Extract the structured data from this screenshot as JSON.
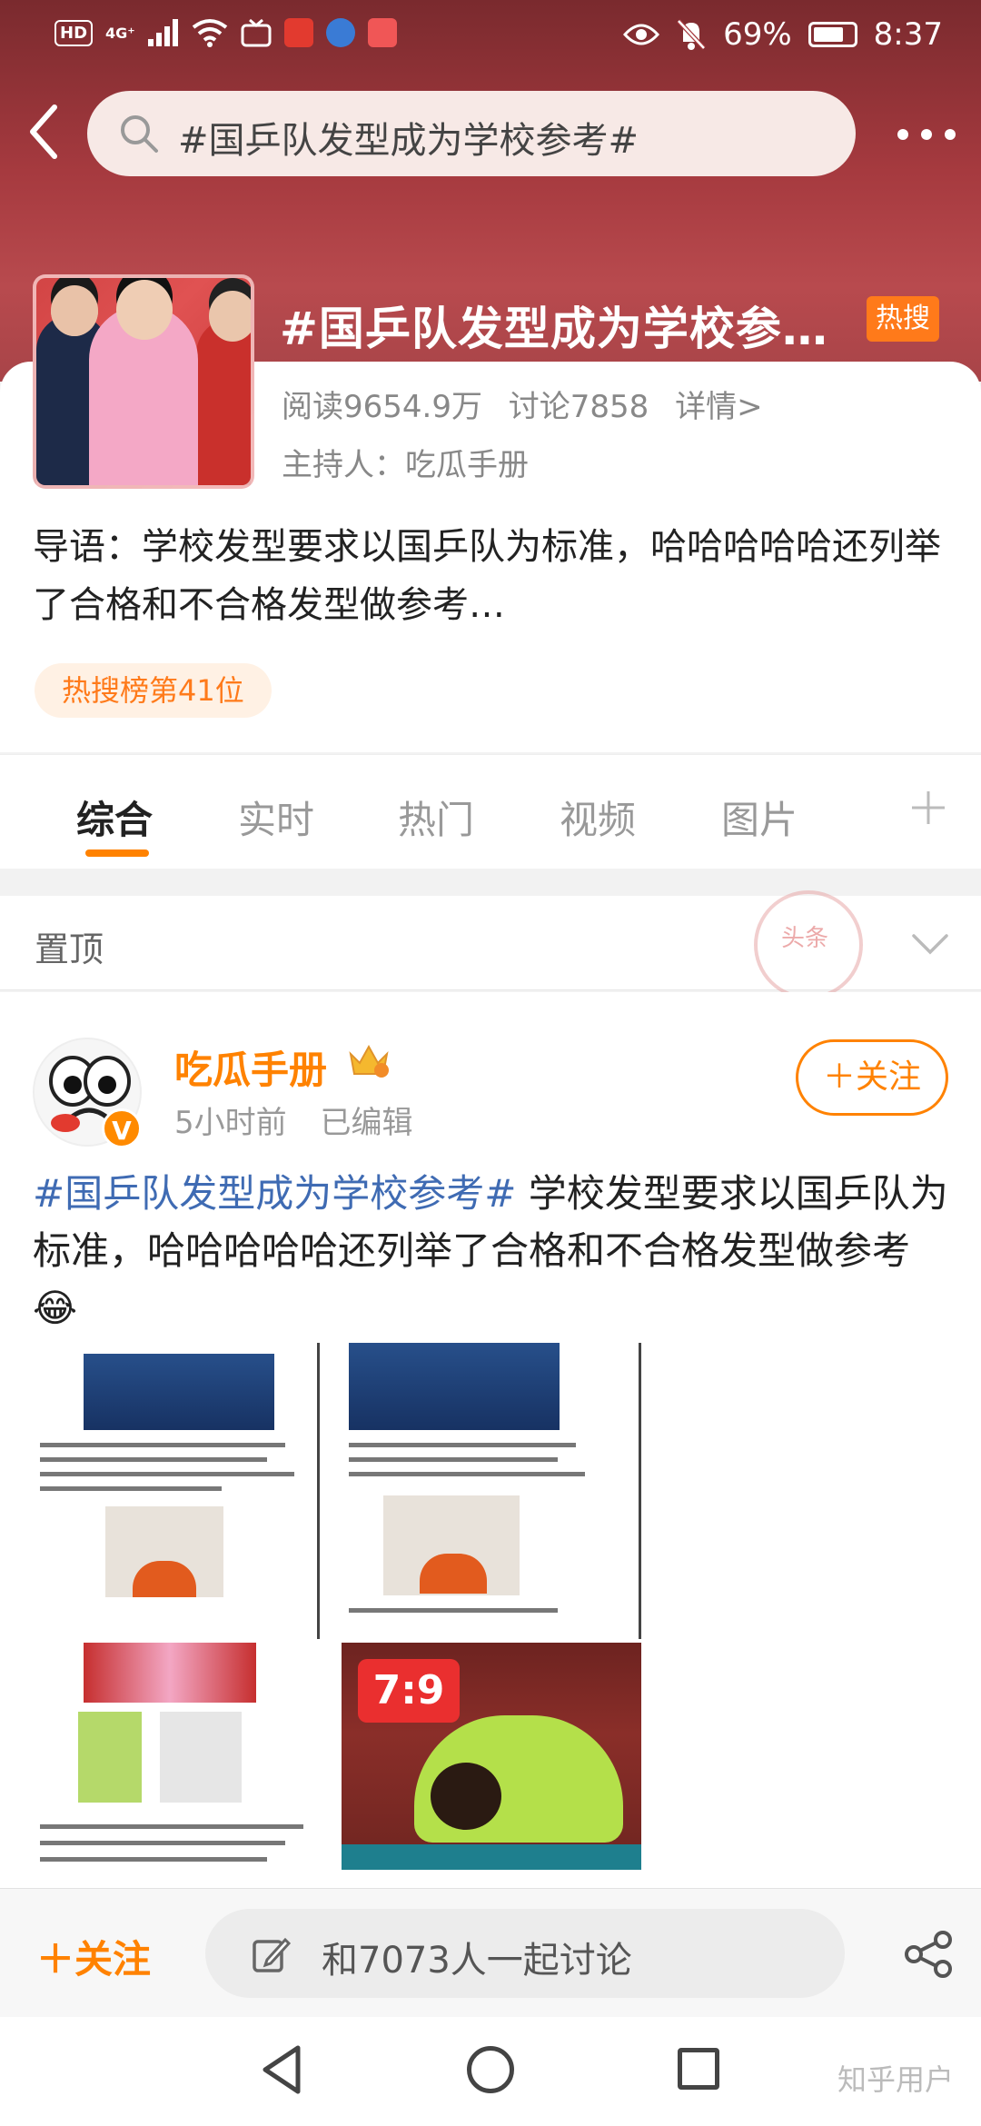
{
  "status_bar": {
    "left_icons": [
      "HD",
      "4G+",
      "signal",
      "wifi",
      "tv",
      "app-red",
      "app-blue",
      "app-red2"
    ],
    "signal_label": "4G⁺",
    "hd_label": "HD",
    "battery": "69%",
    "time": "8:37"
  },
  "search": {
    "query": "#国乒队发型成为学校参考#"
  },
  "topic": {
    "title": "#国乒队发型成为学校参…",
    "badge": "热搜",
    "reads": "阅读9654.9万",
    "discussions": "讨论7858",
    "details": "详情>",
    "host": "主持人：吃瓜手册",
    "intro": "导语：学校发型要求以国乒队为标准，哈哈哈哈哈还列举了合格和不合格发型做参考…",
    "rank": "热搜榜第41位"
  },
  "tabs": [
    {
      "label": "综合",
      "active": true
    },
    {
      "label": "实时",
      "active": false
    },
    {
      "label": "热门",
      "active": false
    },
    {
      "label": "视频",
      "active": false
    },
    {
      "label": "图片",
      "active": false
    }
  ],
  "pinned": {
    "label": "置顶",
    "stamp": "头条"
  },
  "post": {
    "author": "吃瓜手册",
    "v_badge": "V",
    "time": "5小时前",
    "edited": "已编辑",
    "follow": "＋关注",
    "hashtag": "#国乒队发型成为学校参考#",
    "body": " 学校发型要求以国乒队为标准，哈哈哈哈哈还列举了合格和不合格发型做参考😂",
    "score": "7:9"
  },
  "bottom_bar": {
    "follow": "＋关注",
    "discuss_placeholder": "和7073人一起讨论"
  },
  "watermark": "知乎用户",
  "colors": {
    "accent": "#ff8200",
    "hashtag": "#3f6bb3",
    "header": "#a63a3f",
    "hot_badge": "#ff7a1a"
  }
}
